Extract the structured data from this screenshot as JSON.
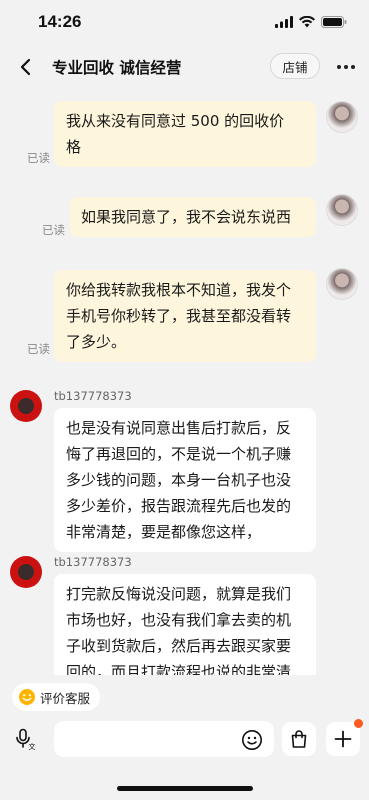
{
  "status_bar": {
    "time": "14:26"
  },
  "nav": {
    "title": "专业回收 诚信经营",
    "store_label": "店铺"
  },
  "messages": [
    {
      "side": "out",
      "read": "已读",
      "lines": [
        "我从来没有同意过 500 的回收价",
        "格"
      ]
    },
    {
      "side": "out",
      "read": "已读",
      "lines": [
        "如果我同意了，我不会说东说西"
      ]
    },
    {
      "side": "out",
      "read": "已读",
      "lines": [
        "你给我转款我根本不知道，我发个",
        "手机号你秒转了，我甚至都没看转",
        "了多少。"
      ]
    },
    {
      "side": "in",
      "sender": "tb137778373",
      "lines": [
        "也是没有说同意出售后打款后，反",
        "悔了再退回的，不是说一个机子赚",
        "多少钱的问题，本身一台机子也没",
        "多少差价，报告跟流程先后也发的",
        "非常清楚，要是都像您这样，"
      ]
    },
    {
      "side": "in",
      "sender": "tb137778373",
      "lines": [
        "打完款反悔说没问题，就算是我们",
        "市场也好，也没有我们拿去卖的机",
        "子收到货款后，然后再去跟买家要",
        "回的，而且打款流程也说的非常清"
      ]
    }
  ],
  "bottom": {
    "eval_label": "评价客服",
    "input_value": "",
    "input_placeholder": ""
  },
  "colors": {
    "bubble_out": "#fdf6dc",
    "bubble_in": "#ffffff",
    "background": "#f2f2f2",
    "badge": "#ff5a1f"
  }
}
